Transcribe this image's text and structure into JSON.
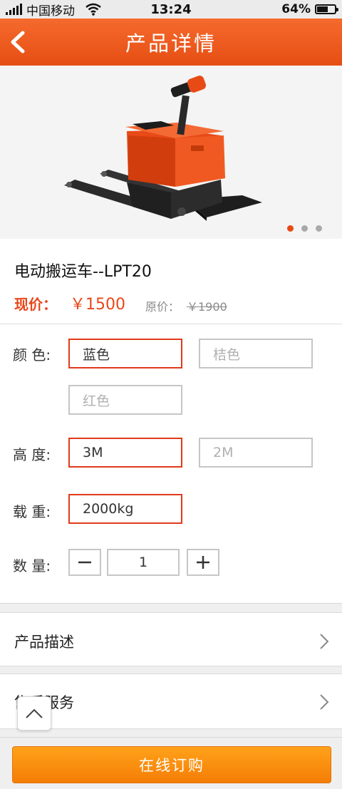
{
  "status_bar": {
    "carrier": "中国移动",
    "time": "13:24",
    "battery": "64%",
    "battery_level": 0.64
  },
  "header": {
    "title": "产品详情"
  },
  "carousel": {
    "slides": 3,
    "active_index": 0
  },
  "product": {
    "name": "电动搬运车--LPT20",
    "price_label": "现价：",
    "price": "￥1500",
    "original_price_label": "原价：",
    "original_price": "￥1900"
  },
  "options": {
    "color": {
      "label": "颜 色:",
      "values": [
        "蓝色",
        "桔色",
        "红色"
      ],
      "selected": "蓝色"
    },
    "height": {
      "label": "高 度:",
      "values": [
        "3M",
        "2M"
      ],
      "selected": "3M"
    },
    "load": {
      "label": "载 重:",
      "values": [
        "2000kg"
      ],
      "selected": "2000kg"
    },
    "quantity": {
      "label": "数 量:",
      "value": "1"
    }
  },
  "sections": {
    "description": "产品描述",
    "service": "售后服务"
  },
  "buy_button": "在线订购",
  "colors": {
    "header": "#e9541a",
    "accent": "#e8471a",
    "buy_button": "#f88a0b",
    "selected_border": "#e03a1b"
  }
}
